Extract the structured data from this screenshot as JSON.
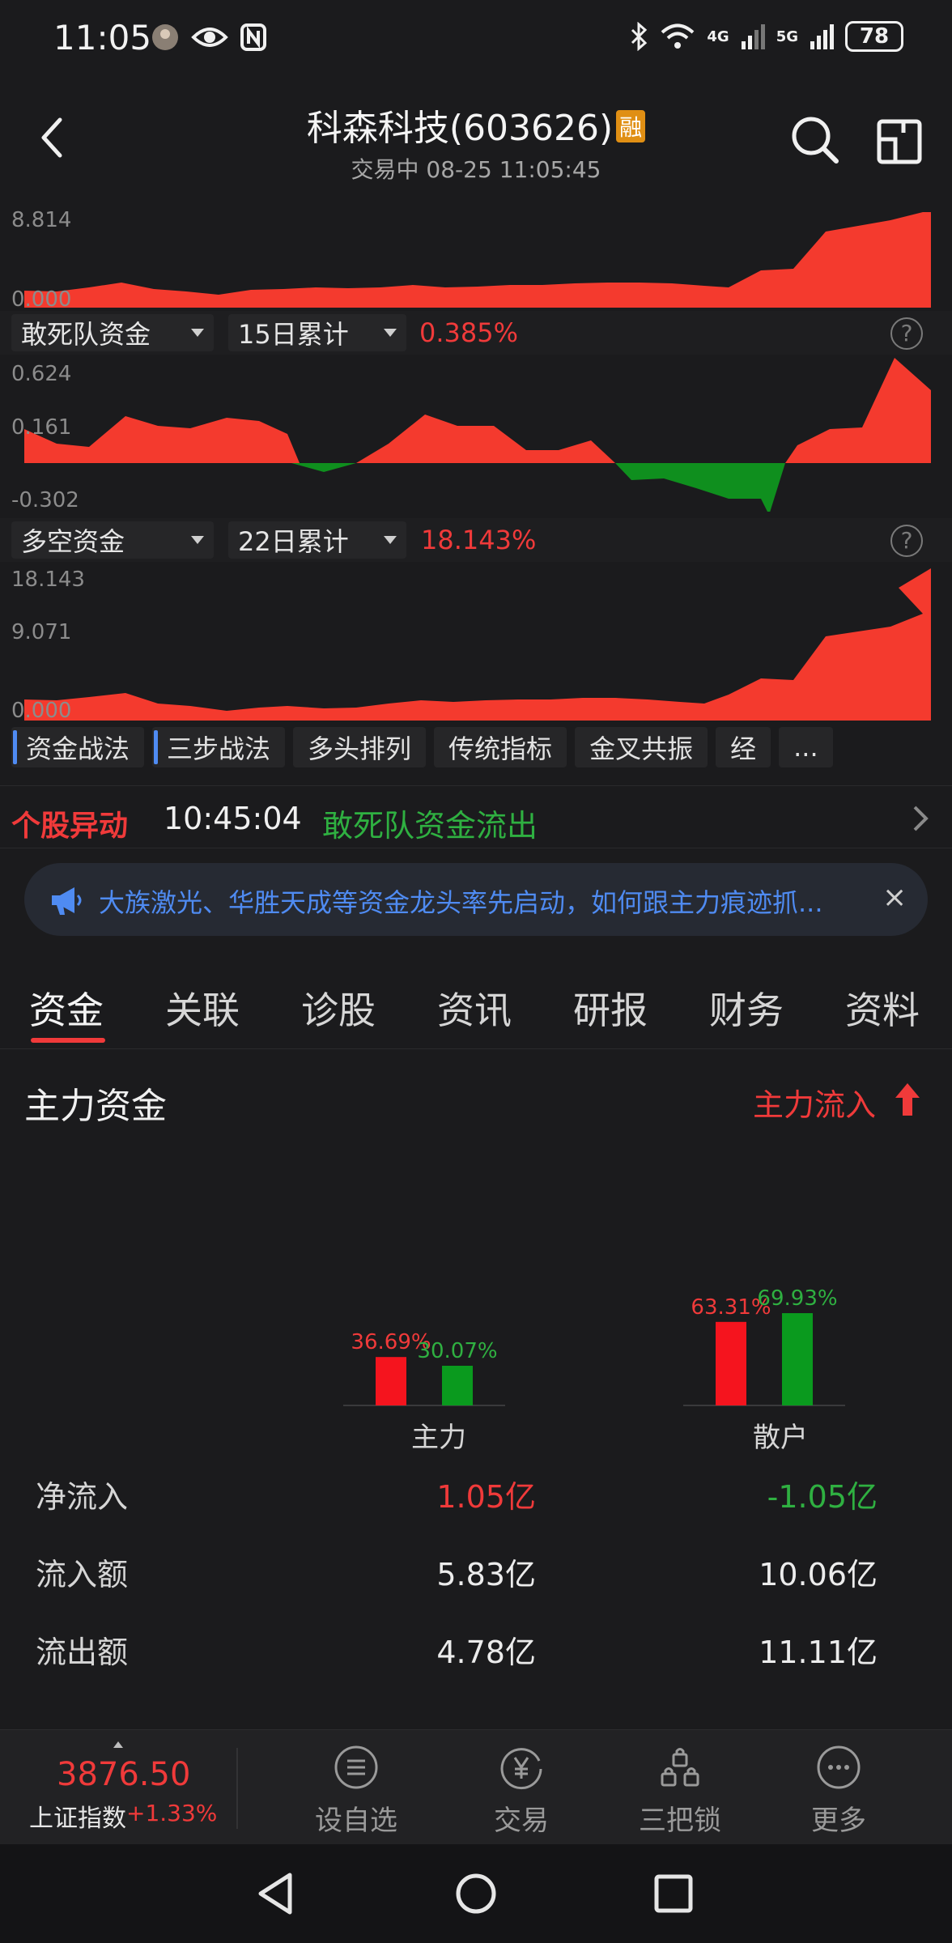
{
  "status_bar": {
    "time": "11:05",
    "battery": "78",
    "net1": "4G",
    "net2": "5G"
  },
  "header": {
    "title": "科森科技(603626)",
    "badge": "融",
    "subtitle": "交易中 08-25 11:05:45"
  },
  "chart1": {
    "y_max": "8.814",
    "y_min": "0.000"
  },
  "indicator2": {
    "name": "敢死队资金",
    "period": "15日累计",
    "value": "0.385%",
    "y_max": "0.624",
    "y_mid": "0.161",
    "y_min": "-0.302"
  },
  "indicator3": {
    "name": "多空资金",
    "period": "22日累计",
    "value": "18.143%",
    "y_max": "18.143",
    "y_mid": "9.071",
    "y_min": "0.000"
  },
  "strategy_tabs": [
    "资金战法",
    "三步战法",
    "多头排列",
    "传统指标",
    "金叉共振",
    "经",
    "..."
  ],
  "anomaly": {
    "title": "个股异动",
    "time": "10:45:04",
    "text": "敢死队资金流出"
  },
  "banner": {
    "text": "大族激光、华胜天成等资金龙头率先启动，如何跟主力痕迹抓...",
    "close": "×"
  },
  "tabs": [
    "资金",
    "关联",
    "诊股",
    "资讯",
    "研报",
    "财务",
    "资料"
  ],
  "main_funds": {
    "title": "主力资金",
    "status": "主力流入",
    "colors": {
      "inflow": "#f5141e",
      "outflow": "#0a9a1e"
    }
  },
  "chart_data": {
    "type": "bar",
    "categories": [
      "主力",
      "散户"
    ],
    "series": [
      {
        "values": [
          36.69,
          63.31
        ],
        "labels": [
          "36.69%",
          "63.31%"
        ]
      },
      {
        "values": [
          30.07,
          69.93
        ],
        "labels": [
          "30.07%",
          "69.93%"
        ]
      }
    ]
  },
  "table": [
    {
      "name": "净流入",
      "main": "1.05亿",
      "retail": "-1.05亿"
    },
    {
      "name": "流入额",
      "main": "5.83亿",
      "retail": "10.06亿"
    },
    {
      "name": "流出额",
      "main": "4.78亿",
      "retail": "11.11亿"
    }
  ],
  "bottom_bar": {
    "index_value": "3876.50",
    "index_name": "上证指数",
    "index_change": "+1.33%",
    "items": [
      "设自选",
      "交易",
      "三把锁",
      "更多"
    ]
  }
}
